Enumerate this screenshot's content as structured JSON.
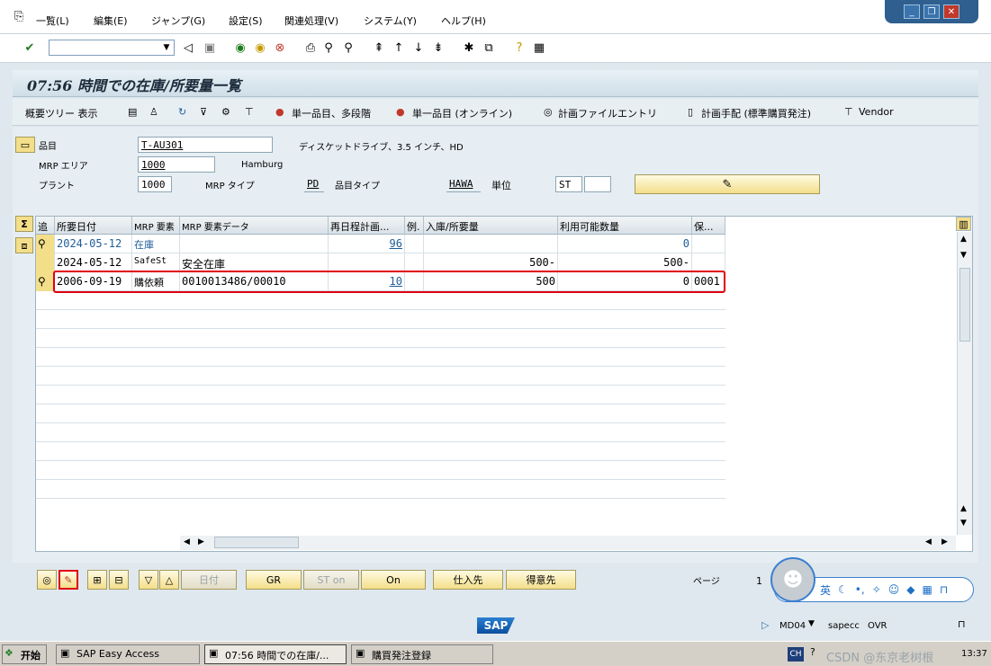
{
  "menu": {
    "items": [
      "一覧(L)",
      "編集(E)",
      "ジャンプ(G)",
      "設定(S)",
      "関連処理(V)",
      "システム(Y)",
      "ヘルプ(H)"
    ]
  },
  "window_controls": {
    "minimize": "_",
    "restore": "❐",
    "close": "✕"
  },
  "title": "07:56 時間での在庫/所要量一覧",
  "app_toolbar": {
    "tree": "概要ツリー 表示",
    "single_multi": "単一品目、多段階",
    "single_online": "単一品目 (オンライン)",
    "plan_file": "計画ファイルエントリ",
    "plan_proc": "計画手配 (標準購買発注)",
    "vendor": "Vendor"
  },
  "header": {
    "material_label": "品目",
    "material_value": "T-AU301",
    "material_desc": "ディスケットドライブ、3.5 インチ、HD",
    "mrp_area_label": "MRP エリア",
    "mrp_area_value": "1000",
    "mrp_area_desc": "Hamburg",
    "plant_label": "プラント",
    "plant_value": "1000",
    "mrp_type_label": "MRP タイプ",
    "mrp_type_value": "PD",
    "mat_type_label": "品目タイプ",
    "mat_type_value": "HAWA",
    "unit_label": "単位",
    "unit_value": "ST"
  },
  "grid": {
    "headers": [
      "追",
      "所要日付",
      "MRP 要素",
      "MRP 要素データ",
      "再日程計画...",
      "例.",
      "入庫/所要量",
      "利用可能数量",
      "保..."
    ],
    "rows": [
      {
        "date": "2024-05-12",
        "elem": "在庫",
        "data": "",
        "resched": "96",
        "exc": "",
        "qty": "",
        "avail": "0",
        "store": ""
      },
      {
        "date": "2024-05-12",
        "elem": "SafeSt",
        "data": "安全在庫",
        "resched": "",
        "exc": "",
        "qty": "500-",
        "avail": "500-",
        "store": ""
      },
      {
        "date": "2006-09-19",
        "elem": "購依頼",
        "data": "0010013486/00010",
        "resched": "10",
        "exc": "",
        "qty": "500",
        "avail": "0",
        "store": "0001"
      }
    ]
  },
  "bottom": {
    "date_btn": "日付",
    "gr_btn": "GR",
    "st_btn": "ST on",
    "on_btn": "On",
    "vendor_btn": "仕入先",
    "customer_btn": "得意先",
    "page_label": "ページ",
    "page_value": "1",
    "ime_label": "英"
  },
  "status": {
    "brand": "SAP",
    "tcode": "MD04",
    "host": "sapecc",
    "mode": "OVR"
  },
  "taskbar": {
    "start": "开始",
    "tasks": [
      "SAP Easy Access",
      "07:56 時間での在庫/...",
      "購買発注登録"
    ],
    "lang": "CH",
    "time": "13:37",
    "watermark": "CSDN @东京老树根"
  }
}
